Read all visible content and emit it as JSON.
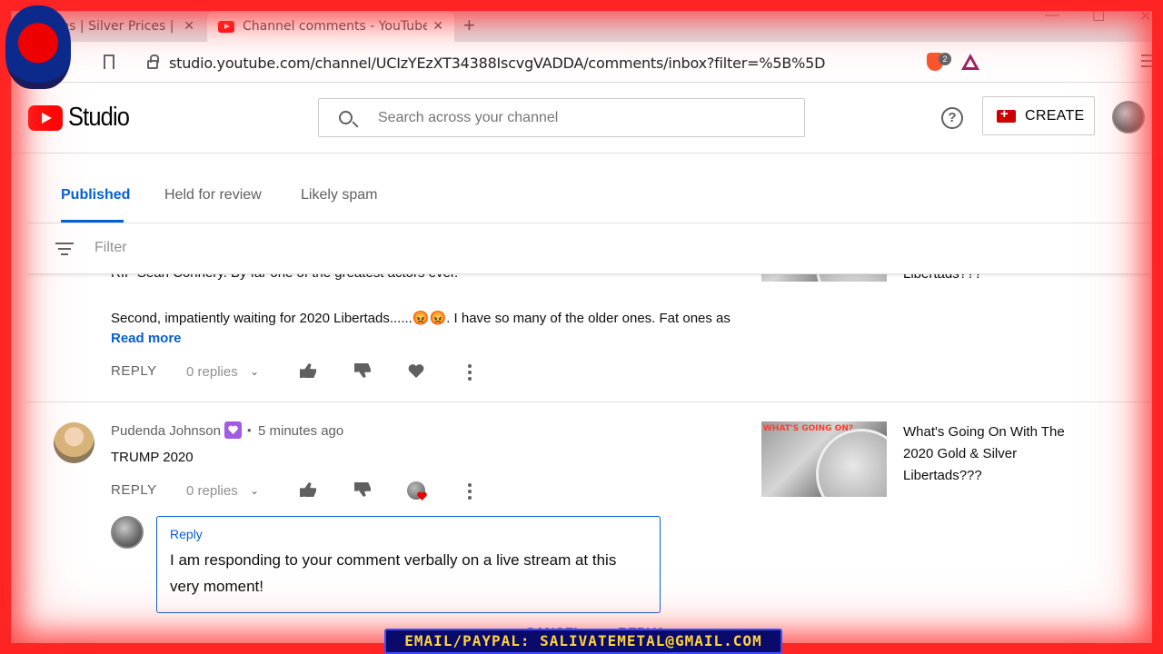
{
  "browser": {
    "tabs": [
      {
        "title": "Prices | Silver Prices | Pla",
        "active": false
      },
      {
        "title": "Channel comments - YouTube Stu",
        "active": true
      }
    ],
    "url": "studio.youtube.com/channel/UCIzYEzXT34388IscvgVADDA/comments/inbox?filter=%5B%5D",
    "extension_badge": "2"
  },
  "studio": {
    "logo_text": "Studio",
    "search_placeholder": "Search across your channel",
    "create_label": "CREATE"
  },
  "comment_tabs": [
    "Published",
    "Held for review",
    "Likely spam"
  ],
  "filter_label": "Filter",
  "comments": [
    {
      "text_line_1": "RIP Sean Connery. By far one of the greatest actors ever.",
      "text_line_2": "Second, impatiently waiting for 2020 Libertads......😡😡. I have so many of the older ones. Fat ones as",
      "read_more": "Read more",
      "reply_label": "REPLY",
      "replies": "0 replies",
      "video_title": "Libertads???"
    },
    {
      "author": "Pudenda Johnson",
      "timestamp": "5 minutes ago",
      "text": "TRUMP 2020",
      "reply_label": "REPLY",
      "replies": "0 replies",
      "video_title": "What's Going On With The 2020 Gold & Silver Libertads???",
      "thumbnail_badge": "WHAT'S GOING ON?"
    }
  ],
  "reply_box": {
    "label": "Reply",
    "text": "I am responding to your comment verbally on a live stream at this very moment!",
    "cancel": "CANCEL",
    "submit": "REPLY"
  },
  "overlay": {
    "watermark": "EMAIL/PAYPAL: SALIVATEMETAL@GMAIL.COM"
  }
}
